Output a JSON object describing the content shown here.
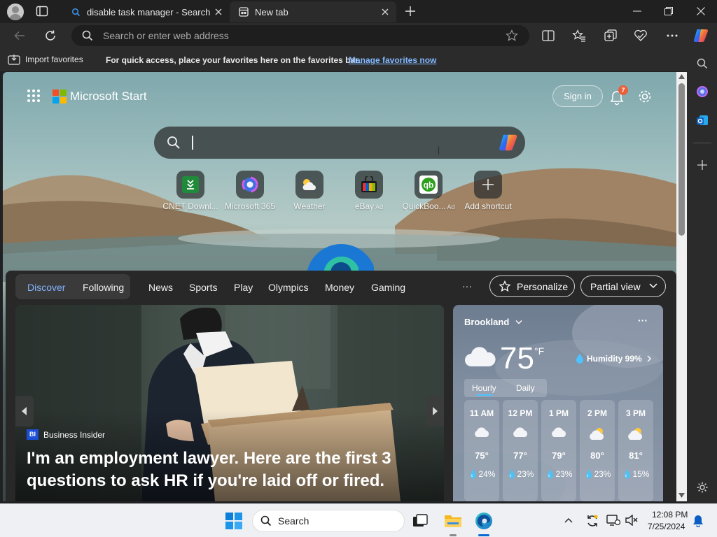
{
  "browser": {
    "tabs": [
      {
        "title": "disable task manager - Search",
        "active": false,
        "icon": "search-favicon"
      },
      {
        "title": "New tab",
        "active": true,
        "icon": "newtab-favicon"
      }
    ],
    "address_placeholder": "Search or enter web address",
    "favorites_bar": {
      "import_label": "Import favorites",
      "message": "For quick access, place your favorites here on the favorites bar.",
      "manage_link": "Manage favorites now"
    }
  },
  "page": {
    "brand": "Microsoft Start",
    "sign_in": "Sign in",
    "notification_count": "7",
    "shortcuts": [
      {
        "label": "CNET Downl...",
        "ad": ""
      },
      {
        "label": "Microsoft 365",
        "ad": ""
      },
      {
        "label": "Weather",
        "ad": ""
      },
      {
        "label": "eBay",
        "ad": "Ad"
      },
      {
        "label": "QuickBoo...",
        "ad": "Ad"
      },
      {
        "label": "Add shortcut",
        "ad": ""
      }
    ],
    "feed_nav": {
      "discover": "Discover",
      "following": "Following",
      "links": [
        "News",
        "Sports",
        "Play",
        "Olympics",
        "Money",
        "Gaming"
      ],
      "more": "···",
      "personalize": "Personalize",
      "partial_view": "Partial view"
    },
    "hero": {
      "source_logo": "BI",
      "source": "Business Insider",
      "headline_line1": "I'm an employment lawyer. Here are the first 3",
      "headline_line2": "questions to ask HR if you're laid off or fired."
    },
    "weather": {
      "location": "Brookland",
      "temperature": "75",
      "unit": "°F",
      "humidity": "Humidity 99%",
      "tabs": [
        "Hourly",
        "Daily"
      ],
      "hours": [
        {
          "time": "11 AM",
          "temp": "75°",
          "precip": "24%",
          "icon": "cloud"
        },
        {
          "time": "12 PM",
          "temp": "77°",
          "precip": "23%",
          "icon": "cloud"
        },
        {
          "time": "1 PM",
          "temp": "79°",
          "precip": "23%",
          "icon": "cloud"
        },
        {
          "time": "2 PM",
          "temp": "80°",
          "precip": "23%",
          "icon": "partly-sunny"
        },
        {
          "time": "3 PM",
          "temp": "81°",
          "precip": "15%",
          "icon": "partly-sunny"
        }
      ]
    }
  },
  "taskbar": {
    "search_label": "Search",
    "time": "12:08 PM",
    "date": "7/25/2024"
  }
}
